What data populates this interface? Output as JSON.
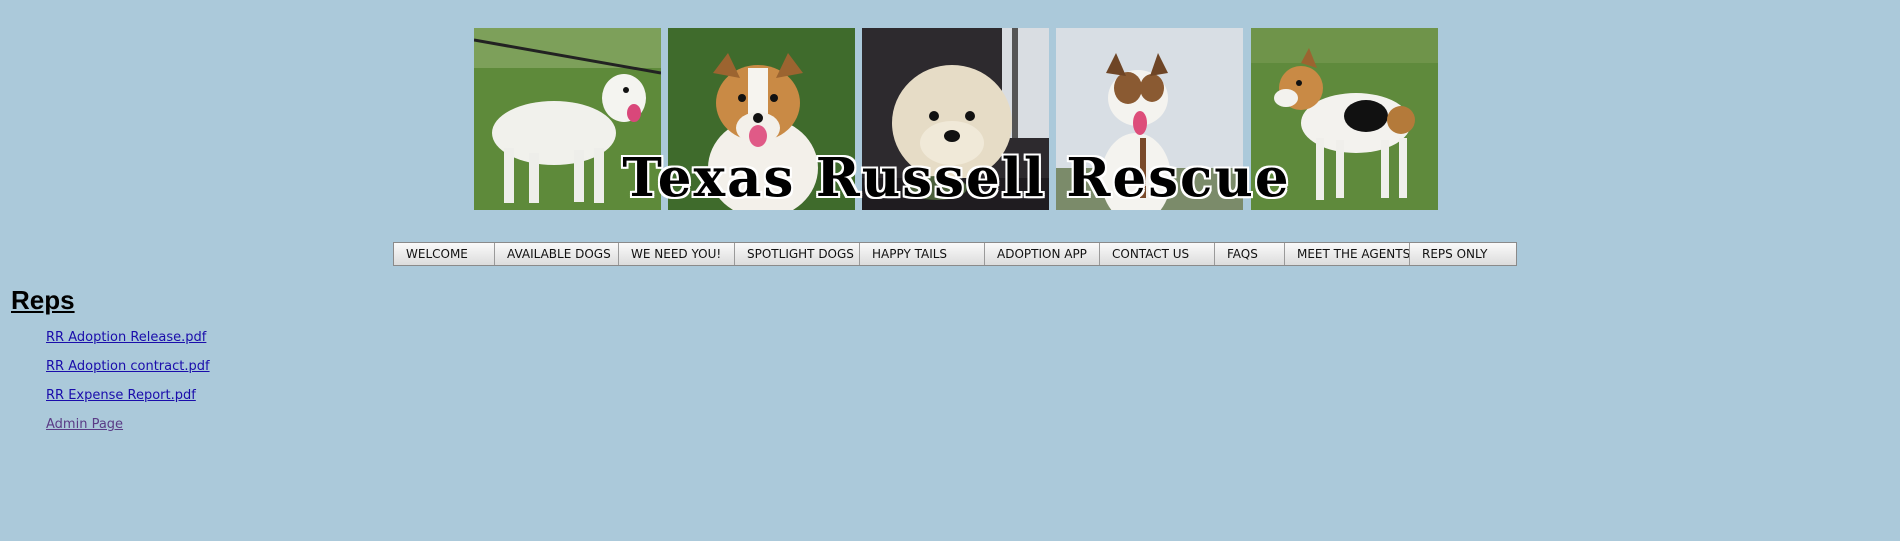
{
  "banner": {
    "title": "Texas Russell Rescue",
    "photos": [
      "dog-photo-1",
      "dog-photo-2",
      "dog-photo-3",
      "dog-photo-4",
      "dog-photo-5"
    ]
  },
  "nav": {
    "items": [
      {
        "label": "WELCOME"
      },
      {
        "label": "AVAILABLE DOGS"
      },
      {
        "label": "WE NEED YOU!"
      },
      {
        "label": "SPOTLIGHT DOGS"
      },
      {
        "label": "HAPPY TAILS"
      },
      {
        "label": "ADOPTION APP"
      },
      {
        "label": "CONTACT US"
      },
      {
        "label": "FAQS"
      },
      {
        "label": "MEET THE AGENTS"
      },
      {
        "label": "REPS ONLY"
      }
    ]
  },
  "main": {
    "heading": "Reps",
    "links": [
      {
        "label": "RR Adoption Release.pdf"
      },
      {
        "label": "RR Adoption contract.pdf"
      },
      {
        "label": "RR Expense Report.pdf"
      },
      {
        "label": "Admin Page"
      }
    ]
  },
  "colors": {
    "background": "#abc9da",
    "link": "#1a0dab",
    "visited_link": "#5a3b86"
  }
}
